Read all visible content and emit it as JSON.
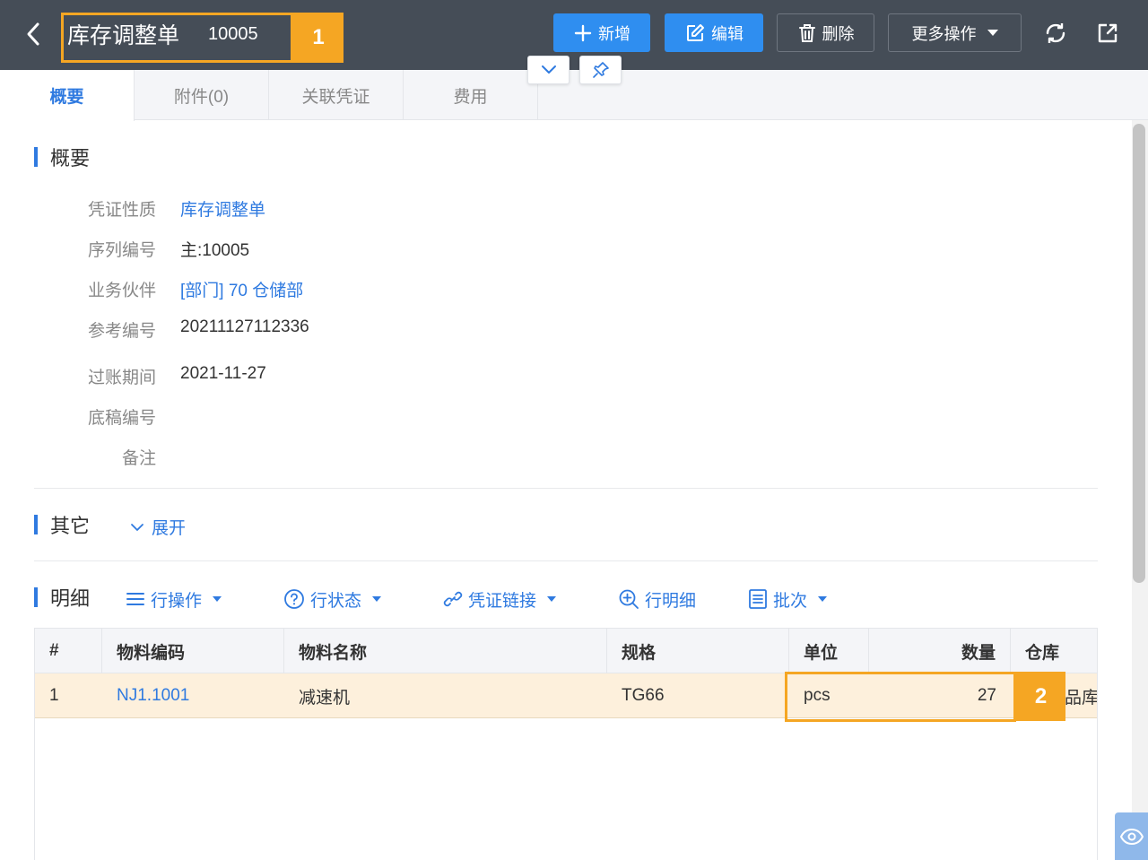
{
  "header": {
    "title": "库存调整单",
    "doc_no": "10005",
    "buttons": {
      "add": "新增",
      "edit": "编辑",
      "delete": "删除",
      "more": "更多操作"
    }
  },
  "tabs": [
    {
      "label": "概要",
      "active": true
    },
    {
      "label": "附件(0)",
      "active": false
    },
    {
      "label": "关联凭证",
      "active": false
    },
    {
      "label": "费用",
      "active": false
    }
  ],
  "summary": {
    "title": "概要",
    "fields": [
      {
        "label": "凭证性质",
        "value": "库存调整单"
      },
      {
        "label": "序列编号",
        "value": "主:10005"
      },
      {
        "label": "业务伙伴",
        "value": "[部门] 70 仓储部"
      },
      {
        "label": "参考编号",
        "value": "20211127112336"
      },
      {
        "label": "过账期间",
        "value": "2021-11-27"
      },
      {
        "label": "底稿编号",
        "value": ""
      },
      {
        "label": "备注",
        "value": ""
      }
    ]
  },
  "other": {
    "title": "其它",
    "expand_label": "展开"
  },
  "detail": {
    "title": "明细",
    "toolbar": {
      "row_ops": "行操作",
      "row_status": "行状态",
      "voucher_link": "凭证链接",
      "row_detail": "行明细",
      "batch": "批次"
    },
    "columns": [
      "#",
      "物料编码",
      "物料名称",
      "规格",
      "单位",
      "数量",
      "仓库"
    ],
    "rows": [
      {
        "no": "1",
        "code": "NJ1.1001",
        "name": "减速机",
        "spec": "TG66",
        "unit": "pcs",
        "qty": "27",
        "warehouse": "品库"
      }
    ]
  },
  "annotations": [
    "1",
    "2"
  ],
  "colors": {
    "header_bg": "#454d57",
    "accent": "#2f7ae0",
    "primary_button": "#2f8ef0",
    "highlight_row": "#fdf0dc",
    "annotation": "#f5a623"
  }
}
